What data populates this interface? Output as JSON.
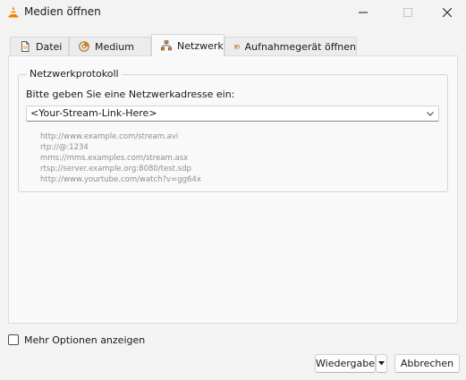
{
  "window": {
    "title": "Medien öffnen"
  },
  "tabs": [
    {
      "label": "Datei",
      "icon": "file-icon",
      "active": false
    },
    {
      "label": "Medium",
      "icon": "disc-icon",
      "active": false
    },
    {
      "label": "Netzwerk",
      "icon": "network-icon",
      "active": true
    },
    {
      "label": "Aufnahmegerät öffnen",
      "icon": "capture-device-icon",
      "active": false
    }
  ],
  "network": {
    "group_title": "Netzwerkprotokoll",
    "prompt": "Bitte geben Sie eine Netzwerkadresse ein:",
    "url_value": "<Your-Stream-Link-Here>",
    "examples": [
      "http://www.example.com/stream.avi",
      "rtp://@:1234",
      "mms://mms.examples.com/stream.asx",
      "rtsp://server.example.org:8080/test.sdp",
      "http://www.yourtube.com/watch?v=gg64x"
    ]
  },
  "footer": {
    "more_options_label": "Mehr Optionen anzeigen",
    "more_options_checked": false,
    "play_label": "Wiedergabe",
    "cancel_label": "Abbrechen"
  },
  "colors": {
    "background": "#f3f3f3",
    "panel": "#f9f9f9",
    "vlc_orange": "#f57c00",
    "example_text": "#8e8e8e"
  }
}
